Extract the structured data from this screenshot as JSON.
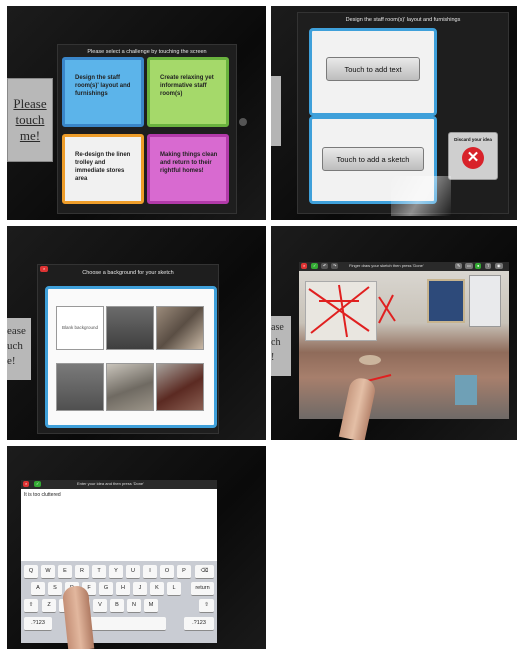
{
  "panel1": {
    "title": "Please select a challenge by touching the screen",
    "sticker": [
      "Please",
      "touch",
      "me!"
    ],
    "tiles": [
      "Design the staff room(s)' layout and furnishings",
      "Create relaxing yet informative staff room(s)",
      "Re-design the linen trolley and immediate stores area",
      "Making things clean and return to their rightful homes!"
    ]
  },
  "panel2": {
    "title": "Design the staff room(s)' layout and furnishings",
    "add_text": "Touch to add text",
    "add_sketch": "Touch to add a sketch",
    "discard": "Discard your idea",
    "discard_icon": "x-circle-icon"
  },
  "panel3": {
    "title": "Choose a background for your sketch",
    "blank": "Blank background",
    "sticker": [
      "ease",
      "uch",
      "e!"
    ]
  },
  "panel4": {
    "toolbar_hint": "Finger draw your sketch then press 'Done'",
    "sticker": [
      "ase",
      "ch",
      "!"
    ]
  },
  "panel5": {
    "header": "Enter your idea and then press 'Done'",
    "typed": "It is too cluttered",
    "keys_row1": [
      "Q",
      "W",
      "E",
      "R",
      "T",
      "Y",
      "U",
      "I",
      "O",
      "P"
    ],
    "keys_row2": [
      "A",
      "S",
      "D",
      "F",
      "G",
      "H",
      "J",
      "K",
      "L"
    ],
    "keys_row3": [
      "Z",
      "X",
      "C",
      "V",
      "B",
      "N",
      "M"
    ],
    "return_key": "return",
    "num_key": ".?123",
    "delete_icon": "backspace-icon",
    "shift_icon": "shift-icon"
  },
  "colors": {
    "blue": "#3fa0da",
    "green": "#6ab23e",
    "orange": "#ee9d2a",
    "purple": "#b23aa9",
    "red": "#d8222a"
  }
}
